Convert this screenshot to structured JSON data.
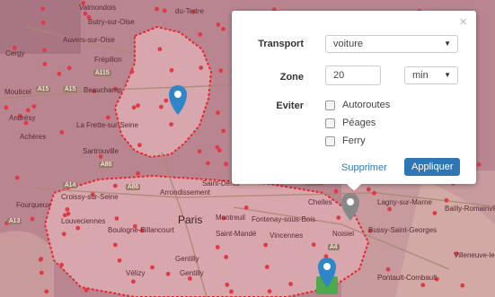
{
  "map": {
    "places": [
      {
        "text": "Valmondois",
        "cls": ""
      },
      {
        "text": "du-Tertre",
        "cls": ""
      },
      {
        "text": "Butry-sur-Oise",
        "cls": ""
      },
      {
        "text": "Auvers-sur-Oise",
        "cls": ""
      },
      {
        "text": "Cergy",
        "cls": ""
      },
      {
        "text": "Frépillon",
        "cls": ""
      },
      {
        "text": "Mouticel",
        "cls": ""
      },
      {
        "text": "Beauchamp",
        "cls": ""
      },
      {
        "text": "Andrésy",
        "cls": ""
      },
      {
        "text": "La Frette-sur-Seine",
        "cls": ""
      },
      {
        "text": "Achères",
        "cls": ""
      },
      {
        "text": "Sartrouville",
        "cls": ""
      },
      {
        "text": "Croissy-sur-Seine",
        "cls": ""
      },
      {
        "text": "Louveciennes",
        "cls": ""
      },
      {
        "text": "Fourqueux",
        "cls": ""
      },
      {
        "text": "Boulogne-Billancourt",
        "cls": ""
      },
      {
        "text": "Paris",
        "cls": "big"
      },
      {
        "text": "Montreuil",
        "cls": ""
      },
      {
        "text": "Fontenay-sous-Bois",
        "cls": ""
      },
      {
        "text": "Saint-Mandé",
        "cls": ""
      },
      {
        "text": "Chelles",
        "cls": ""
      },
      {
        "text": "Lagny-sur-Marne",
        "cls": ""
      },
      {
        "text": "Noisiel",
        "cls": ""
      },
      {
        "text": "Bussy-Saint-Georges",
        "cls": ""
      },
      {
        "text": "Gentilly",
        "cls": ""
      },
      {
        "text": "Vélizy",
        "cls": ""
      },
      {
        "text": "Villeneuve-le-Comte",
        "cls": ""
      },
      {
        "text": "Bailly-Romainvilliers",
        "cls": ""
      },
      {
        "text": "Pontault-Combault",
        "cls": ""
      },
      {
        "text": "Saint-Denis",
        "cls": ""
      },
      {
        "text": "Arrondissement",
        "cls": ""
      },
      {
        "text": "Vincennes",
        "cls": ""
      },
      {
        "text": "Gentilly",
        "cls": ""
      }
    ],
    "roads": [
      "A115",
      "A15",
      "A15",
      "A86",
      "A14",
      "A86",
      "A13",
      "A104",
      "A4"
    ],
    "pin_color": "#2e86c8",
    "pin_gray": "#888888",
    "pin_green": "#4caa4c",
    "zone_color": "#cf8a96",
    "zone_border": "#e6282f"
  },
  "panel": {
    "close_glyph": "×",
    "transport_label": "Transport",
    "transport_value": "voiture",
    "zone_label": "Zone",
    "zone_value": "20",
    "zone_unit": "min",
    "eviter_label": "Eviter",
    "options": [
      "Autoroutes",
      "Péages",
      "Ferry"
    ],
    "delete_label": "Supprimer",
    "apply_label": "Appliquer"
  }
}
